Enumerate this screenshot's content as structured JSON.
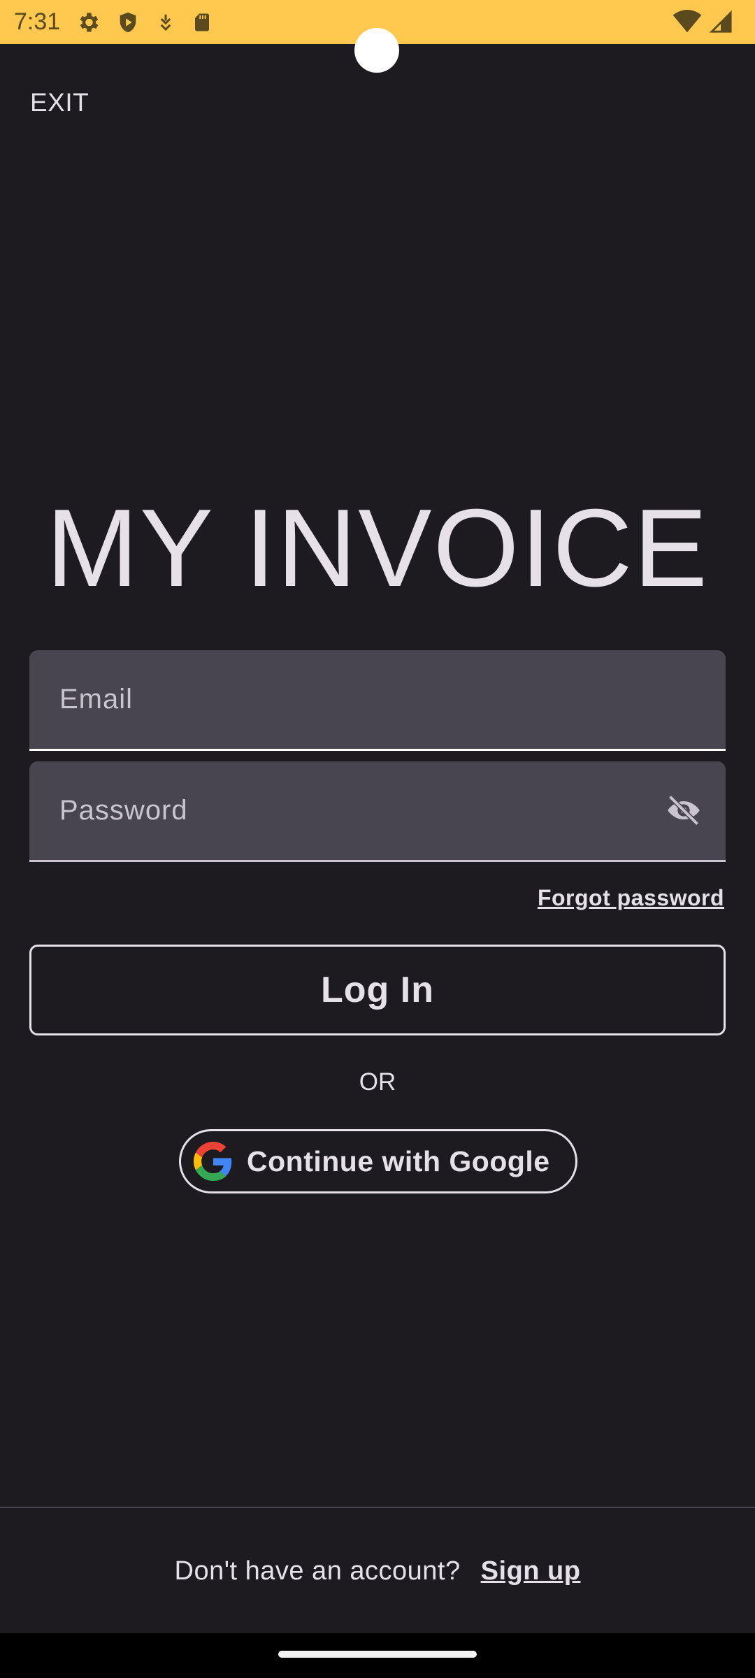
{
  "status_bar": {
    "time": "7:31",
    "left_icons": [
      "gear-icon",
      "shield-play-icon",
      "download-icon",
      "sd-card-icon"
    ],
    "right_icons": [
      "wifi-icon",
      "signal-icon"
    ],
    "background": "#ffc84f"
  },
  "header": {
    "exit_label": "EXIT"
  },
  "app": {
    "title": "MY INVOICE"
  },
  "form": {
    "email_placeholder": "Email",
    "password_placeholder": "Password",
    "password_toggle_icon": "eye-off-icon",
    "forgot_label": "Forgot password",
    "login_label": "Log In",
    "or_label": "OR",
    "google_label": "Continue with Google"
  },
  "footer": {
    "prompt": "Don't have an account?",
    "signup_label": "Sign up"
  },
  "colors": {
    "background": "#1d1b20",
    "field_background": "#49454f",
    "text": "#e6e0e9"
  }
}
